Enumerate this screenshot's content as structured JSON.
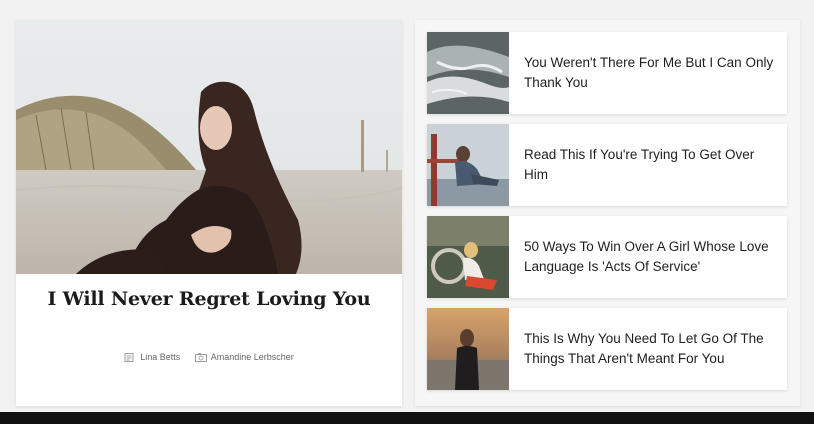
{
  "featured": {
    "title": "I Will Never Regret Loving You",
    "author": "Lina Betts",
    "photographer": "Amandine Lerbscher",
    "author_icon": "document-icon",
    "photographer_icon": "camera-icon"
  },
  "articles": [
    {
      "title": "You Weren't There For Me But I Can Only Thank You"
    },
    {
      "title": "Read This If You're Trying To Get Over Him"
    },
    {
      "title": "50 Ways To Win Over A Girl Whose Love Language Is 'Acts Of Service'"
    },
    {
      "title": "This Is Why You Need To Let Go Of The Things That Aren't Meant For You"
    }
  ],
  "colors": {
    "page_bg": "#f2f2f2",
    "card_bg": "#ffffff",
    "text": "#1f1f1f"
  }
}
